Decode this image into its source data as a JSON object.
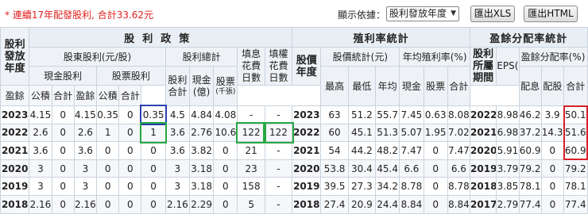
{
  "topbar": {
    "note": "* 連續17年配發股利, 合計33.62元",
    "view_label": "顯示依據：",
    "view_select": "股利發放年度",
    "btn_xls": "匯出XLS",
    "btn_html": "匯出HTML"
  },
  "headers": {
    "group_dividend": "股利政策",
    "group_yield": "殖利率統計",
    "group_payout": "盈餘分配率統計",
    "col_year": "股利發放年度",
    "shareholder_dividend": "股東股利(元/股)",
    "dividend_total_group": "股利總計",
    "fill_dividend_days": "填息花費日數",
    "fill_rights_days": "填權花費日數",
    "cash_dividend": "現金股利",
    "stock_dividend": "股票股利",
    "dividend_total": "股利合計",
    "cash_billion": "現金(億)",
    "stock_thousand": "股票",
    "stock_thousand_unit": "(千張)",
    "stock_price_year": "股價年度",
    "price_stats": "股價統計(元)",
    "avg_yield": "年均殖利率(%)",
    "dividend_period": "股利所屬期間",
    "eps": "EPS(元)",
    "payout_ratio": "盈餘分配率(%)",
    "sub": {
      "surplus": "盈餘",
      "reserve": "公積",
      "total": "合計",
      "high": "最高",
      "low": "最低",
      "avg": "年均",
      "cash": "現金",
      "stock": "股票",
      "div_cash": "配息",
      "div_stock": "配股"
    }
  },
  "rows": [
    {
      "year": "2023",
      "c1": "4.15",
      "c2": "0",
      "c3": "4.15",
      "s1": "0.35",
      "s2": "0",
      "s3": "0.35",
      "tot": "4.5",
      "cash_b": "4.84",
      "stock_k": "4.08",
      "fill_d": "-",
      "fill_r": "-",
      "py": "2023",
      "hi": "63",
      "lo": "51.2",
      "avg": "55.7",
      "yc": "7.45",
      "ys": "0.63",
      "yt": "8.08",
      "per": "2022",
      "eps": "8.98",
      "pc": "46.2",
      "ps": "3.9",
      "pt": "50.1"
    },
    {
      "year": "2022",
      "c1": "2.6",
      "c2": "0",
      "c3": "2.6",
      "s1": "1",
      "s2": "0",
      "s3": "1",
      "tot": "3.6",
      "cash_b": "2.76",
      "stock_k": "10.6",
      "fill_d": "122",
      "fill_r": "122",
      "py": "2022",
      "hi": "60",
      "lo": "45.1",
      "avg": "51.3",
      "yc": "5.07",
      "ys": "1.95",
      "yt": "7.02",
      "per": "2021",
      "eps": "6.98",
      "pc": "37.2",
      "ps": "14.3",
      "pt": "51.6"
    },
    {
      "year": "2021",
      "c1": "3.6",
      "c2": "0",
      "c3": "3.6",
      "s1": "0",
      "s2": "0",
      "s3": "0",
      "tot": "3.6",
      "cash_b": "3.82",
      "stock_k": "0",
      "fill_d": "21",
      "fill_r": "-",
      "py": "2021",
      "hi": "54",
      "lo": "44.2",
      "avg": "48.2",
      "yc": "7.47",
      "ys": "0",
      "yt": "7.47",
      "per": "2020",
      "eps": "5.91",
      "pc": "60.9",
      "ps": "0",
      "pt": "60.9"
    },
    {
      "year": "2020",
      "c1": "3",
      "c2": "0",
      "c3": "3",
      "s1": "0",
      "s2": "0",
      "s3": "0",
      "tot": "3",
      "cash_b": "3.18",
      "stock_k": "0",
      "fill_d": "23",
      "fill_r": "-",
      "py": "2020",
      "hi": "53.8",
      "lo": "30.4",
      "avg": "45.4",
      "yc": "6.6",
      "ys": "0",
      "yt": "6.6",
      "per": "2019",
      "eps": "3.79",
      "pc": "79.2",
      "ps": "0",
      "pt": "79.2"
    },
    {
      "year": "2019",
      "c1": "3",
      "c2": "0",
      "c3": "3",
      "s1": "0",
      "s2": "0",
      "s3": "0",
      "tot": "3",
      "cash_b": "3.18",
      "stock_k": "0",
      "fill_d": "158",
      "fill_r": "-",
      "py": "2019",
      "hi": "39.5",
      "lo": "27.3",
      "avg": "34.2",
      "yc": "8.78",
      "ys": "0",
      "yt": "8.78",
      "per": "2018",
      "eps": "3.85",
      "pc": "78.1",
      "ps": "0",
      "pt": "78.1"
    },
    {
      "year": "2018",
      "c1": "2.16",
      "c2": "0",
      "c3": "2.16",
      "s1": "0",
      "s2": "0",
      "s3": "0",
      "tot": "2.16",
      "cash_b": "2.29",
      "stock_k": "0",
      "fill_d": "5",
      "fill_r": "-",
      "py": "2018",
      "hi": "27.4",
      "lo": "20.9",
      "avg": "24.4",
      "yc": "8.84",
      "ys": "0",
      "yt": "8.84",
      "per": "2017",
      "eps": "2.79",
      "pc": "77.4",
      "ps": "0",
      "pt": "77.4"
    }
  ]
}
